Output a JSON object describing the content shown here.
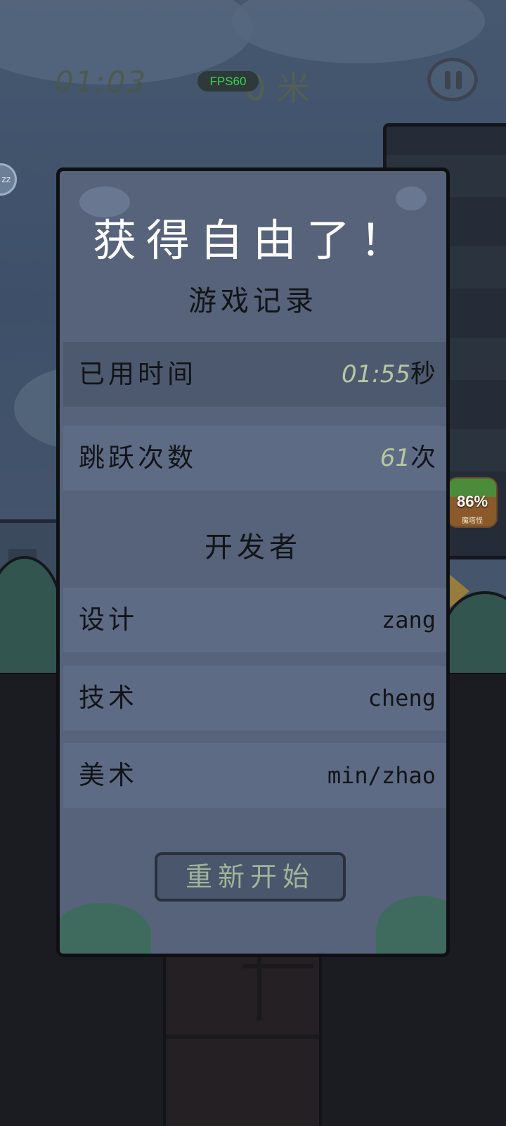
{
  "hud": {
    "timer": "01:03",
    "distance": "0 米",
    "fps": "FPS60",
    "pause_icon": "pause-icon"
  },
  "side_badge": {
    "percent": "86%",
    "caption": "魔塔怪"
  },
  "dialog": {
    "title": "获得自由了！",
    "records_heading": "游戏记录",
    "records": [
      {
        "label": "已用时间",
        "value": "01:55",
        "unit": "秒"
      },
      {
        "label": "跳跃次数",
        "value": "61",
        "unit": "次"
      }
    ],
    "credits_heading": "开发者",
    "credits": [
      {
        "label": "设计",
        "value": "zang"
      },
      {
        "label": "技术",
        "value": "cheng"
      },
      {
        "label": "美术",
        "value": "min/zhao"
      }
    ],
    "restart_label": "重新开始"
  },
  "colors": {
    "dialog_bg": "#56637b",
    "row_bg": "#5e6b84",
    "row_alt_bg": "#4d596e",
    "number_accent": "#b8c7a0",
    "fps_green": "#39d353"
  }
}
